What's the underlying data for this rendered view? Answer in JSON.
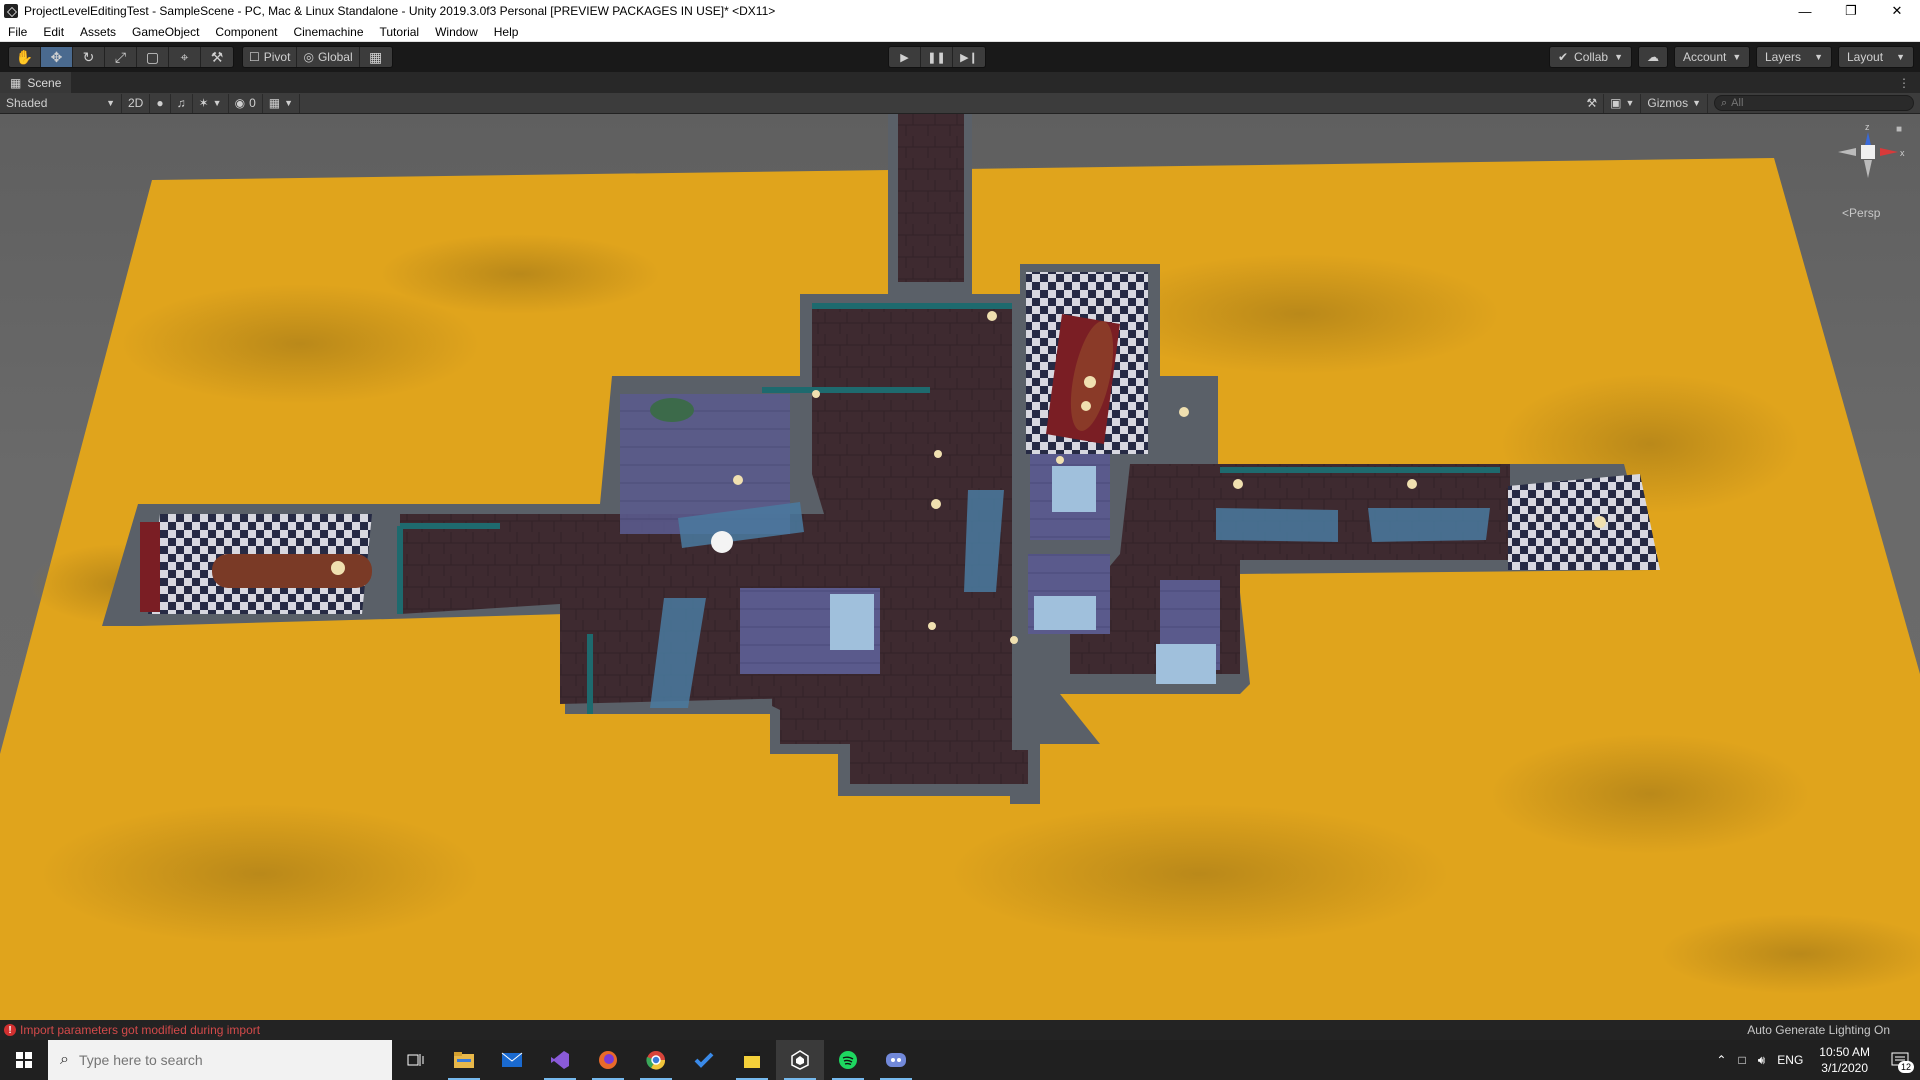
{
  "window": {
    "title": "ProjectLevelEditingTest - SampleScene - PC, Mac & Linux Standalone - Unity 2019.3.0f3 Personal [PREVIEW PACKAGES IN USE]* <DX11>",
    "minimize_icon": "minimize-icon",
    "restore_icon": "restore-icon",
    "close_icon": "close-icon"
  },
  "menu": [
    "File",
    "Edit",
    "Assets",
    "GameObject",
    "Component",
    "Cinemachine",
    "Tutorial",
    "Window",
    "Help"
  ],
  "toolbar": {
    "tools": [
      "hand-tool-icon",
      "move-tool-icon",
      "rotate-tool-icon",
      "scale-tool-icon",
      "rect-tool-icon",
      "transform-tool-icon",
      "custom-tool-icon"
    ],
    "active_tool": "move-tool-icon",
    "pivot_label": "Pivot",
    "global_label": "Global",
    "play_controls": [
      "play-icon",
      "pause-icon",
      "step-icon"
    ],
    "collab_label": "Collab",
    "account_label": "Account",
    "layers_label": "Layers",
    "layout_label": "Layout"
  },
  "scene_tab": {
    "label": "Scene"
  },
  "scene_controls": {
    "shading_mode": "Shaded",
    "mode_2d": "2D",
    "hidden_count": "0",
    "gizmos_label": "Gizmos",
    "search_placeholder": "All"
  },
  "gizmo": {
    "y_label": "z",
    "x_label": "x",
    "projection_label": "Persp"
  },
  "status": {
    "error_message": "Import parameters got modified during import",
    "right_message": "Auto Generate Lighting On"
  },
  "taskbar": {
    "search_placeholder": "Type here to search",
    "apps": [
      "task-view-icon",
      "file-explorer-icon",
      "mail-icon",
      "visual-studio-icon",
      "firefox-icon",
      "chrome-icon",
      "todo-icon",
      "sticky-notes-icon",
      "unity-icon",
      "spotify-icon",
      "discord-icon"
    ],
    "active_app": "unity-icon",
    "language": "ENG",
    "time": "10:50 AM",
    "date": "3/1/2020",
    "notification_count": "12"
  },
  "colors": {
    "ground": "#e0a41c",
    "floor": "#3e2a30",
    "wall": "#5a6068",
    "wall_teal": "#1e6a6e",
    "rug": "#4a7aa0",
    "checker_dark": "#262a44",
    "carpet_red": "#7a1e24",
    "accent_blue": "#4a6a8f",
    "error_red": "#d24a4a"
  }
}
